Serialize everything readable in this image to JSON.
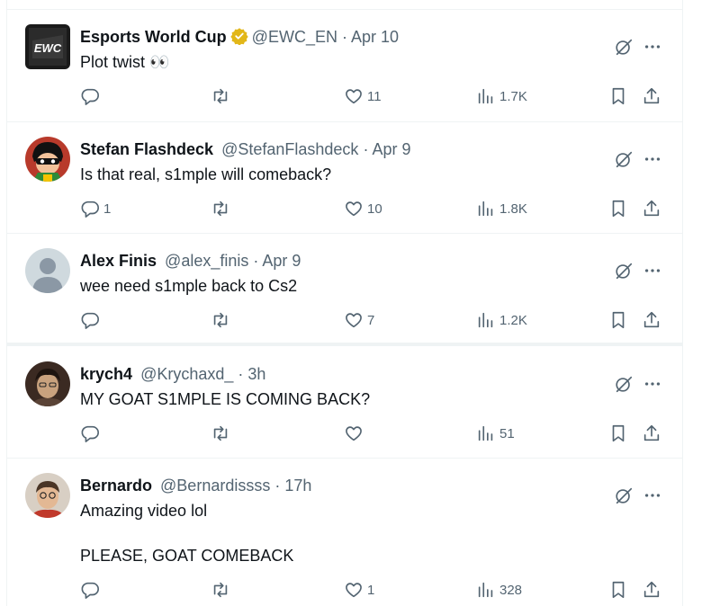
{
  "tweets": [
    {
      "name": "Esports World Cup",
      "verified": true,
      "handle": "@EWC_EN",
      "separator": "·",
      "date": "Apr 10",
      "text": "Plot twist 👀",
      "avatar_text": "EWC",
      "reply_count": "",
      "retweet_count": "",
      "like_count": "11",
      "view_count": "1.7K"
    },
    {
      "name": "Stefan Flashdeck",
      "verified": false,
      "handle": "@StefanFlashdeck",
      "separator": "·",
      "date": "Apr 9",
      "text": "Is that real, s1mple will comeback?",
      "reply_count": "1",
      "retweet_count": "",
      "like_count": "10",
      "view_count": "1.8K"
    },
    {
      "name": "Alex Finis",
      "verified": false,
      "handle": "@alex_finis",
      "separator": "·",
      "date": "Apr 9",
      "text": "wee need s1mple back to Cs2",
      "reply_count": "",
      "retweet_count": "",
      "like_count": "7",
      "view_count": "1.2K"
    },
    {
      "name": "krych4",
      "verified": false,
      "handle": "@Krychaxd_",
      "separator": "·",
      "date": "3h",
      "text": "MY GOAT S1MPLE IS COMING BACK?",
      "reply_count": "",
      "retweet_count": "",
      "like_count": "",
      "view_count": "51"
    },
    {
      "name": "Bernardo",
      "verified": false,
      "handle": "@Bernardissss",
      "separator": "·",
      "date": "17h",
      "text": "Amazing video lol\n\nPLEASE, GOAT COMEBACK",
      "reply_count": "",
      "retweet_count": "",
      "like_count": "1",
      "view_count": "328"
    }
  ],
  "colors": {
    "text_primary": "#0f1419",
    "text_secondary": "#536471",
    "divider": "#eff3f4",
    "verified_gold": "#e2b719"
  },
  "icons": {
    "reply": "reply-icon",
    "retweet": "retweet-icon",
    "like": "heart-icon",
    "views": "views-icon",
    "bookmark": "bookmark-icon",
    "share": "share-icon",
    "grok": "grok-icon",
    "more": "more-icon"
  }
}
